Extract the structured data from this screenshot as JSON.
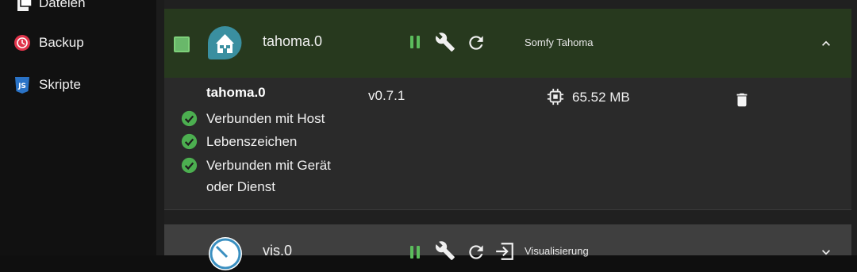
{
  "sidebar": {
    "items": [
      {
        "label": "Dateien",
        "icon": "file-icon"
      },
      {
        "label": "Backup",
        "icon": "backup-icon",
        "color": "#e0344b"
      },
      {
        "label": "Skripte",
        "icon": "javascript-icon",
        "color": "#2a73c7"
      }
    ]
  },
  "adapters": [
    {
      "name": "tahoma.0",
      "title": "Somfy Tahoma",
      "expanded": true,
      "selected": true,
      "detail": {
        "name": "tahoma.0",
        "version": "v0.7.1",
        "memory": "65.52 MB",
        "statuses": [
          {
            "text": "Verbunden mit Host"
          },
          {
            "text": "Lebenszeichen"
          },
          {
            "text": "Verbunden mit Gerät oder Dienst"
          }
        ]
      }
    },
    {
      "name": "vis.0",
      "title": "Visualisierung",
      "expanded": false
    }
  ],
  "colors": {
    "accent_green": "#5bbd5c",
    "header_green": "#27391e",
    "brand_red": "#e0344b",
    "brand_blue": "#2a73c7"
  }
}
